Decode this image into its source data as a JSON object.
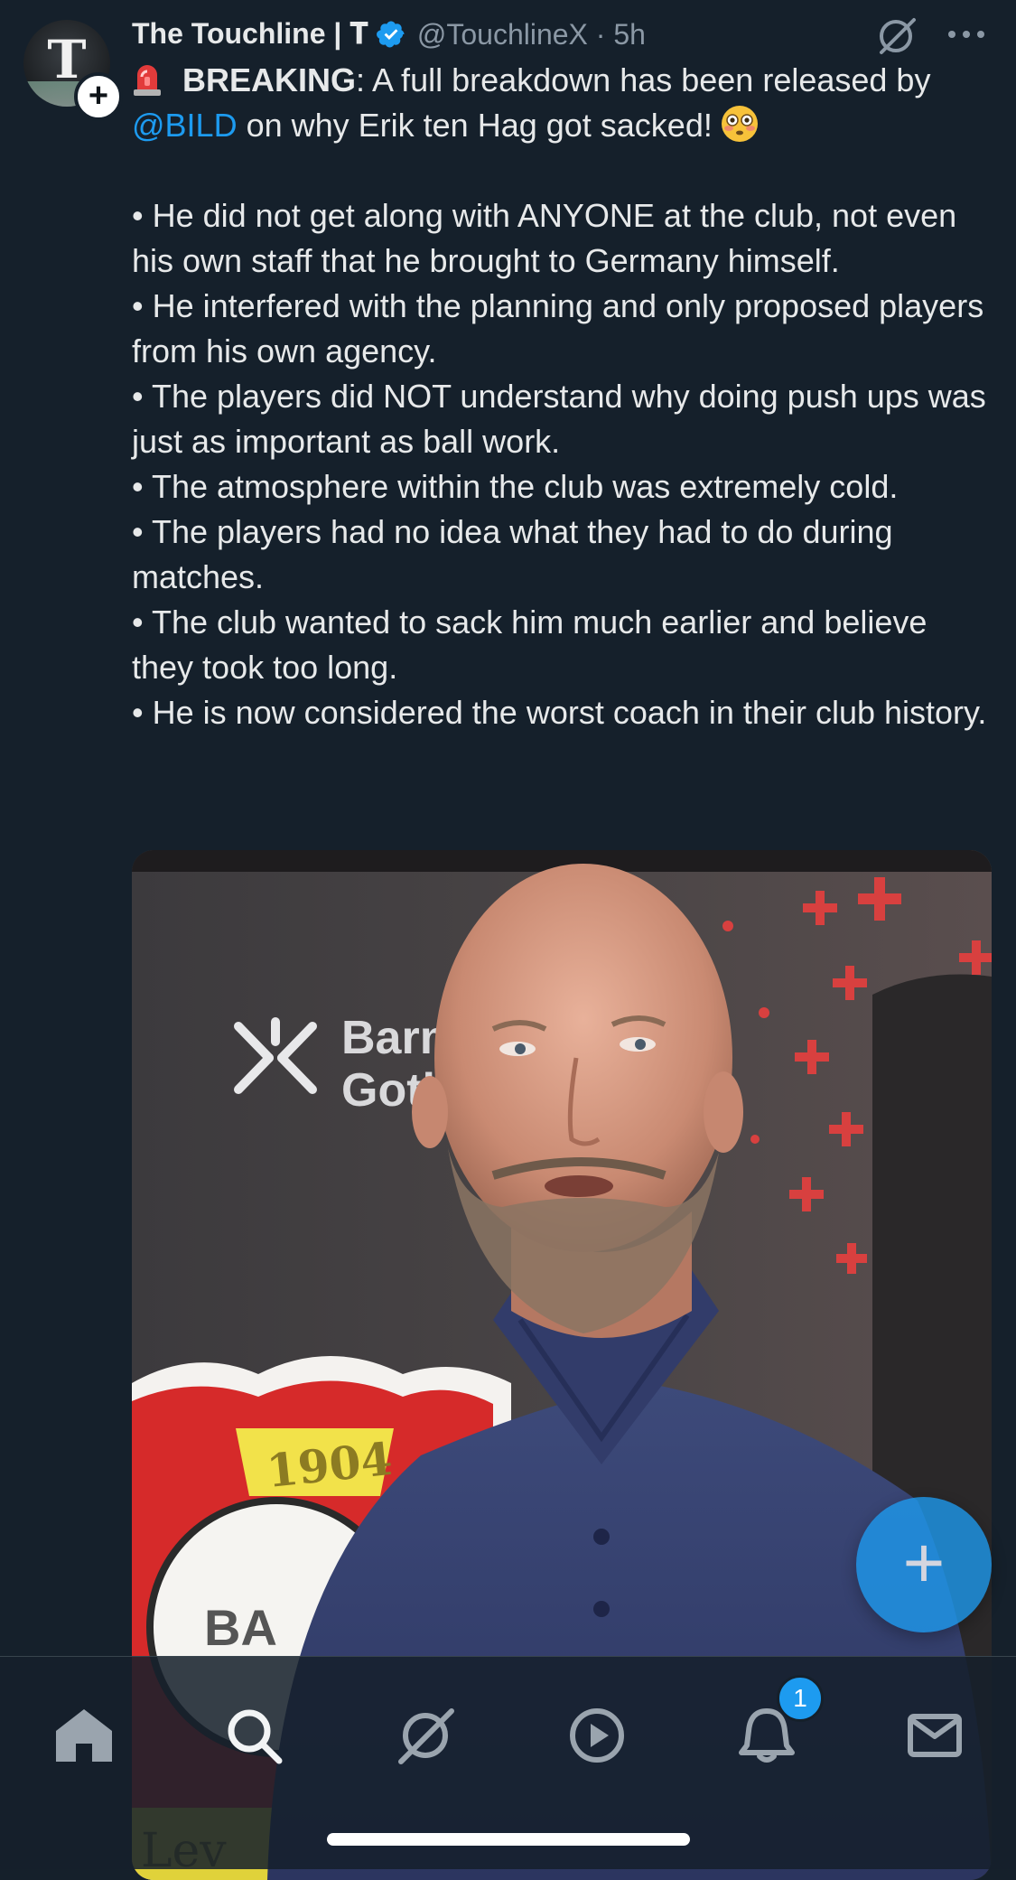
{
  "tweet": {
    "author_name": "The Touchline | 𝐓",
    "handle_time": "@TouchlineX · 5h",
    "avatar_monogram": "T",
    "body": {
      "breaking_label": "BREAKING",
      "intro_before_mention": ": A full breakdown has been released by ",
      "mention": "@BILD",
      "intro_after_mention": " on why Erik ten Hag got sacked!",
      "bullets": [
        "• He did not get along with ANYONE at the club, not even his own staff that he brought to Germany himself.",
        "• He interfered with the planning and only proposed players from his own agency.",
        "• The players did NOT understand why doing push ups was just as important as ball work.",
        "• The atmosphere within the club was extremely cold.",
        "• The players had no idea what they had to do during matches.",
        "• The club wanted to sack him much earlier and believe they took too long.",
        "• He is now considered the worst coach in their club history."
      ]
    },
    "media": {
      "sponsor_text_line1": "Barm",
      "sponsor_text_line2": "Goth",
      "crest_year": "1904",
      "crest_letters": "BA",
      "lower_text": "Lev"
    }
  },
  "fab": {
    "label": "+"
  },
  "bottom_nav": {
    "items": [
      {
        "icon": "home-icon"
      },
      {
        "icon": "search-icon"
      },
      {
        "icon": "grok-icon"
      },
      {
        "icon": "video-play-icon"
      },
      {
        "icon": "notifications-bell-icon"
      },
      {
        "icon": "messages-envelope-icon"
      }
    ],
    "notification_count": "1"
  },
  "colors": {
    "background": "#15202b",
    "accent": "#1d9bf0",
    "text_primary": "#e7e9ea",
    "text_secondary": "#8b98a5"
  }
}
